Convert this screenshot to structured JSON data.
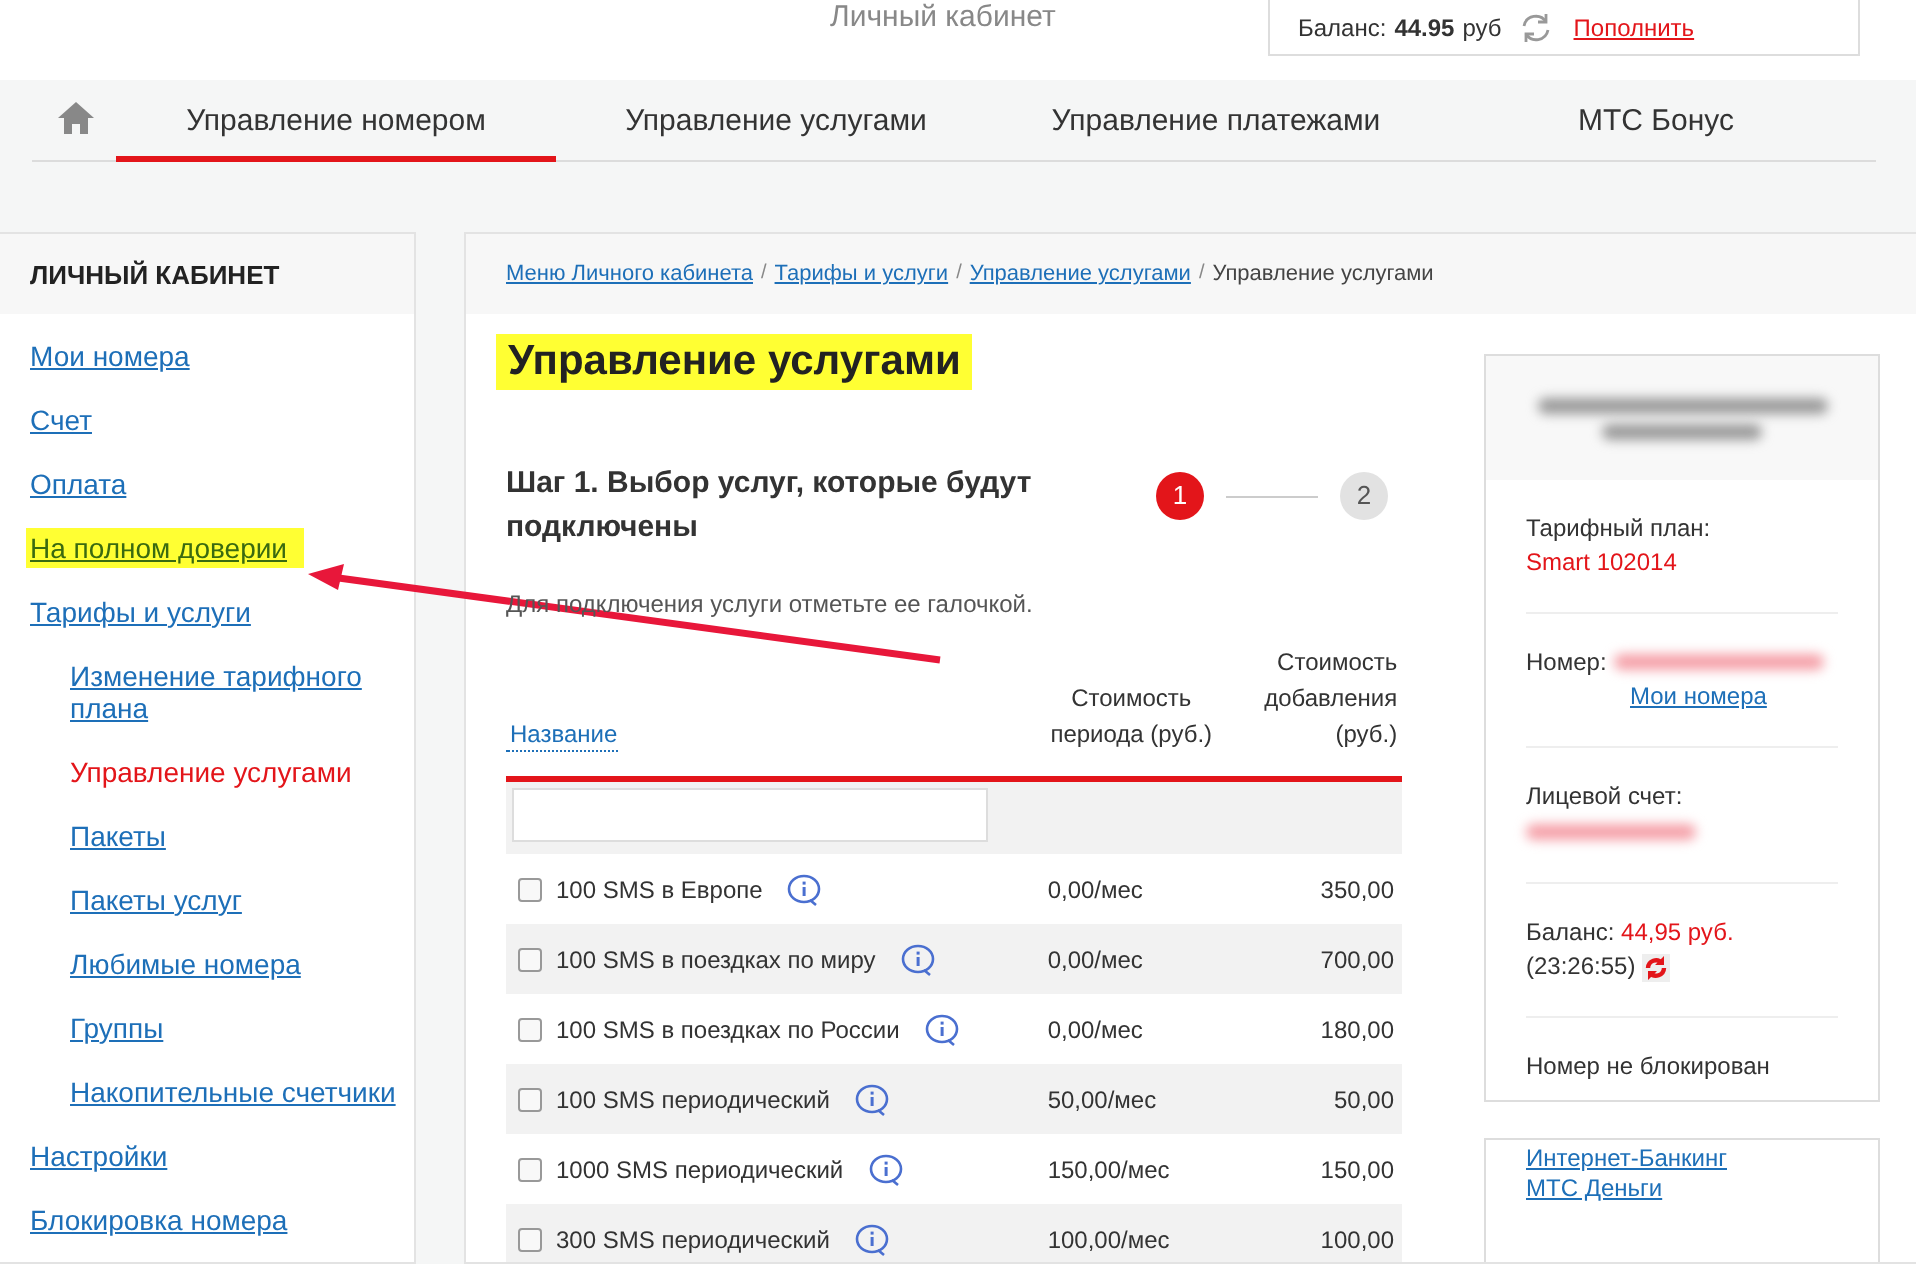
{
  "header": {
    "title": "Личный кабинет",
    "balance_label": "Баланс:",
    "balance_value": "44.95",
    "balance_unit": "руб",
    "topup_link": "Пополнить"
  },
  "nav": {
    "tabs": [
      {
        "label": "Управление номером",
        "selected": true
      },
      {
        "label": "Управление услугами",
        "selected": false
      },
      {
        "label": "Управление платежами",
        "selected": false
      },
      {
        "label": "МТС Бонус",
        "selected": false
      }
    ]
  },
  "sidebar": {
    "title": "ЛИЧНЫЙ КАБИНЕТ",
    "items": [
      {
        "label": "Мои номера",
        "selected": false,
        "highlighted": false
      },
      {
        "label": "Счет",
        "selected": false,
        "highlighted": false
      },
      {
        "label": "Оплата",
        "selected": false,
        "highlighted": false
      },
      {
        "label": "На полном доверии",
        "selected": false,
        "highlighted": true
      },
      {
        "label": "Тарифы и услуги",
        "selected": false,
        "highlighted": false,
        "children": [
          {
            "label": "Изменение тарифного плана",
            "selected": false,
            "highlighted": false
          },
          {
            "label": "Управление услугами",
            "selected": true,
            "highlighted": false
          },
          {
            "label": "Пакеты",
            "selected": false,
            "highlighted": false
          },
          {
            "label": "Пакеты услуг",
            "selected": false,
            "highlighted": false
          },
          {
            "label": "Любимые номера",
            "selected": false,
            "highlighted": false
          },
          {
            "label": "Группы",
            "selected": false,
            "highlighted": false
          },
          {
            "label": "Накопительные счетчики",
            "selected": false,
            "highlighted": false
          }
        ]
      },
      {
        "label": "Настройки",
        "selected": false,
        "highlighted": false
      },
      {
        "label": "Блокировка номера",
        "selected": false,
        "highlighted": false
      }
    ]
  },
  "breadcrumbs": [
    {
      "label": "Меню Личного кабинета",
      "kind": "link"
    },
    {
      "separator": "/",
      "label": "Тарифы и услуги",
      "kind": "link"
    },
    {
      "separator": "/",
      "label": "Управление услугами",
      "kind": "link"
    },
    {
      "separator": "/",
      "label": "Управление услугами",
      "kind": "current"
    }
  ],
  "page_title": {
    "text": "Управление услугами",
    "highlighted": true
  },
  "step": {
    "title": "Шаг 1. Выбор услуг, которые будут подключены",
    "steps": [
      {
        "label": "1",
        "selected": true
      },
      {
        "label": "2",
        "selected": false
      }
    ]
  },
  "hint": "Для подключения услуги отметьте ее галочкой.",
  "table": {
    "columns": [
      "Название",
      "Стоимость периода (руб.)",
      "Стоимость добавления (руб.)"
    ],
    "rows": [
      {
        "name": "100 SMS в Европе",
        "period": "0,00/мес",
        "add": "350,00",
        "checked": false
      },
      {
        "name": "100 SMS в поездках по миру",
        "period": "0,00/мес",
        "add": "700,00",
        "checked": false
      },
      {
        "name": "100 SMS в поездках по России",
        "period": "0,00/мес",
        "add": "180,00",
        "checked": false
      },
      {
        "name": "100 SMS периодический",
        "period": "50,00/мес",
        "add": "50,00",
        "checked": false
      },
      {
        "name": "1000 SMS периодический",
        "period": "150,00/мес",
        "add": "150,00",
        "checked": false
      },
      {
        "name": "300 SMS периодический",
        "period": "100,00/мес",
        "add": "100,00",
        "checked": false
      }
    ]
  },
  "account": {
    "tariff_label": "Тарифный план:",
    "tariff_value": "Smart 102014",
    "number_label": "Номер:",
    "numbers_link": "Мои номера",
    "account_label": "Лицевой счет:",
    "balance_label": "Баланс:",
    "balance_value": "44,95 руб.",
    "balance_time": "(23:26:55)",
    "status": "Номер не блокирован"
  },
  "links": [
    "Интернет-Банкинг МТС Деньги"
  ]
}
